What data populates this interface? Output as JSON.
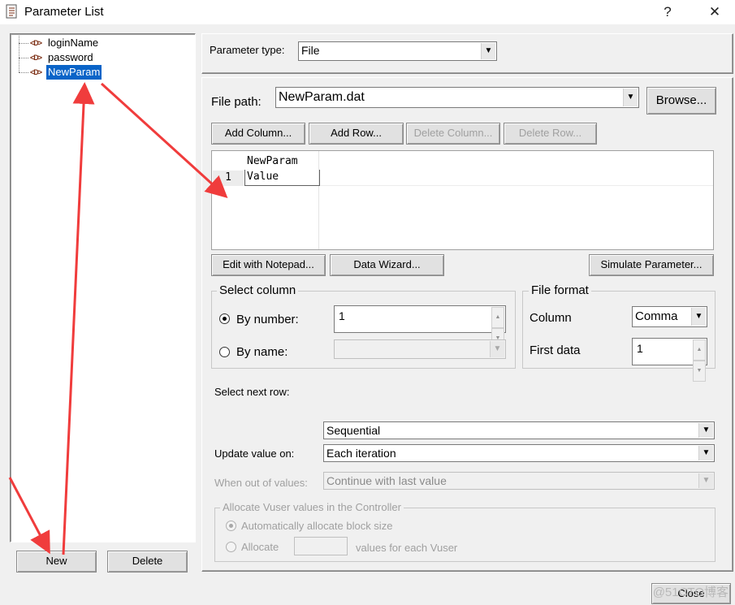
{
  "window": {
    "title": "Parameter List",
    "help_label": "?",
    "close_label": "✕"
  },
  "tree": {
    "items": [
      {
        "label": "loginName",
        "selected": false
      },
      {
        "label": "password",
        "selected": false
      },
      {
        "label": "NewParam",
        "selected": true
      }
    ],
    "icon_text": "<D>"
  },
  "left_buttons": {
    "new_label": "New",
    "delete_label": "Delete"
  },
  "param_type": {
    "label": "Parameter type:",
    "value": "File"
  },
  "file_path": {
    "label": "File path:",
    "value": "NewParam.dat",
    "browse_label": "Browse..."
  },
  "grid_buttons": {
    "add_column": "Add Column...",
    "add_row": "Add Row...",
    "delete_column": "Delete Column...",
    "delete_row": "Delete Row..."
  },
  "grid": {
    "header": "NewParam",
    "rows": [
      {
        "num": "1",
        "value": "Value"
      }
    ]
  },
  "tool_buttons": {
    "edit_notepad": "Edit with Notepad...",
    "data_wizard": "Data Wizard...",
    "simulate": "Simulate Parameter..."
  },
  "select_column": {
    "title": "Select column",
    "by_number_label": "By number:",
    "by_number_value": "1",
    "by_name_label": "By name:",
    "by_name_value": ""
  },
  "file_format": {
    "title": "File format",
    "column_label": "Column",
    "column_value": "Comma",
    "first_data_label": "First data",
    "first_data_value": "1"
  },
  "next_row": {
    "label": "Select next row:",
    "value": "Sequential"
  },
  "update_value": {
    "label": "Update value on:",
    "value": "Each iteration"
  },
  "out_of_values": {
    "label": "When out of values:",
    "value": "Continue with last value"
  },
  "allocate": {
    "title": "Allocate Vuser values in the Controller",
    "auto_label": "Automatically allocate block size",
    "manual_label": "Allocate",
    "manual_value": "",
    "suffix_label": "values for each Vuser"
  },
  "footer": {
    "close_label": "Close"
  },
  "watermark": "@51CTO博客",
  "colors": {
    "selection": "#0a64c8",
    "annotation_arrow": "#f03c3c",
    "dialog_bg": "#f0f0f0"
  }
}
